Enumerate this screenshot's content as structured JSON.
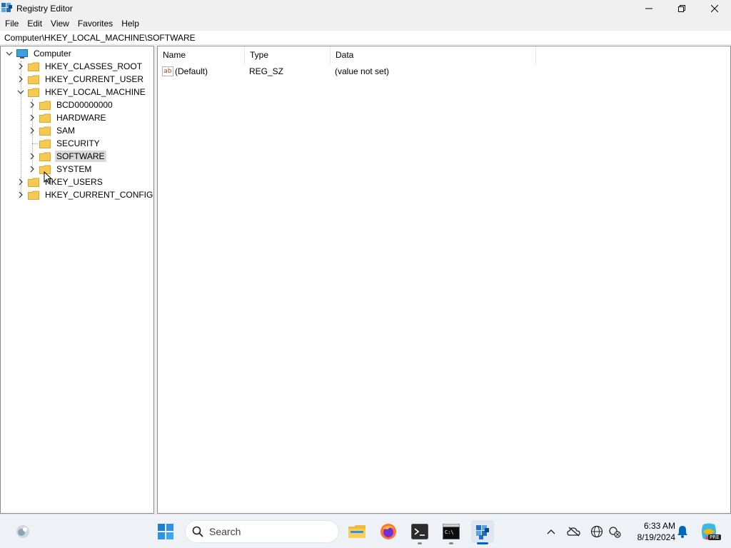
{
  "window": {
    "title": "Registry Editor",
    "controls": [
      "minimize",
      "restore",
      "close"
    ]
  },
  "menu": [
    "File",
    "Edit",
    "View",
    "Favorites",
    "Help"
  ],
  "address": "Computer\\HKEY_LOCAL_MACHINE\\SOFTWARE",
  "tree": {
    "root": "Computer",
    "hives": [
      "HKEY_CLASSES_ROOT",
      "HKEY_CURRENT_USER",
      "HKEY_LOCAL_MACHINE",
      "HKEY_USERS",
      "HKEY_CURRENT_CONFIG"
    ],
    "hklm_children": [
      "BCD00000000",
      "HARDWARE",
      "SAM",
      "SECURITY",
      "SOFTWARE",
      "SYSTEM"
    ],
    "selected": "SOFTWARE"
  },
  "list": {
    "columns": [
      "Name",
      "Type",
      "Data"
    ],
    "rows": [
      {
        "name": "(Default)",
        "type": "REG_SZ",
        "data": "(value not set)",
        "icon": "string-value-icon"
      }
    ]
  },
  "taskbar": {
    "search_placeholder": "Search",
    "apps": [
      "widgets-icon",
      "start-icon",
      "file-explorer-icon",
      "firefox-icon",
      "terminal-icon",
      "command-prompt-icon",
      "registry-editor-icon"
    ],
    "clock_time": "6:33 AM",
    "clock_date": "8/19/2024",
    "tray": [
      "chevron-up-icon",
      "onedrive-icon",
      "network-icon",
      "security-icon",
      "notification-icon",
      "copilot-icon"
    ],
    "copilot_badge": "PRE"
  },
  "colors": {
    "chrome_bg": "#f0f0f0",
    "folder": "#f6c950",
    "selected_bg": "#d9d9d9",
    "accent": "#0067c0",
    "taskbar_bg": "#eef1f6"
  }
}
